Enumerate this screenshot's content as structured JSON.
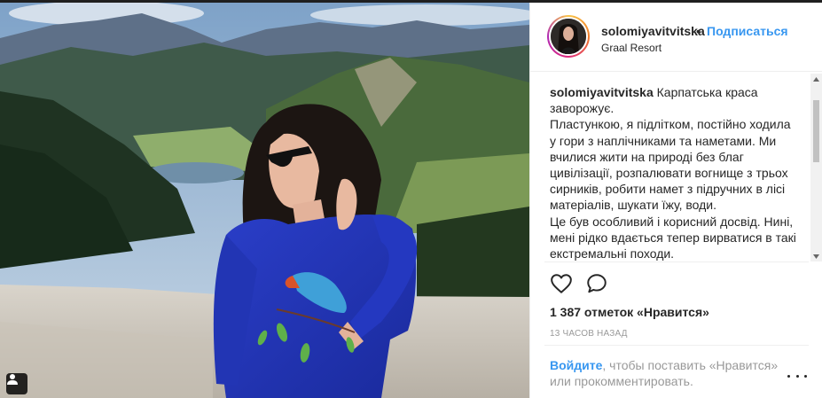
{
  "post": {
    "username": "solomiyavitvitska",
    "follow_separator": "•",
    "follow_label": "Подписаться",
    "location": "Graal Resort",
    "caption_user": "solomiyavitvitska",
    "caption_lines": [
      "Карпатська краса заворожує.",
      "Пластункою, я підлітком, постійно ходила у гори з наплічниками та наметами. Ми вчилися жити на природі без благ цивілізації, розпалювати вогнище з трьох сирників, робити намет з підручних в лісі матеріалів, шукати їжу, води.",
      "Це був особливий і корисний досвід. Нині, мені рідко вдається тепер вирватися в такі екстремальні походи."
    ],
    "likes_text": "1 387 отметок «Нравится»",
    "time_text": "13 часов назад",
    "login_link": "Войдите",
    "login_rest": ", чтобы поставить «Нравится» или прокомментировать."
  },
  "icons": {
    "like": "heart-outline-icon",
    "comment": "comment-bubble-icon",
    "more": "more-options-icon",
    "user_tags": "user-tag-icon"
  },
  "colors": {
    "link_blue": "#3897f0",
    "text": "#262626",
    "muted": "#999999",
    "border": "#efefef"
  }
}
